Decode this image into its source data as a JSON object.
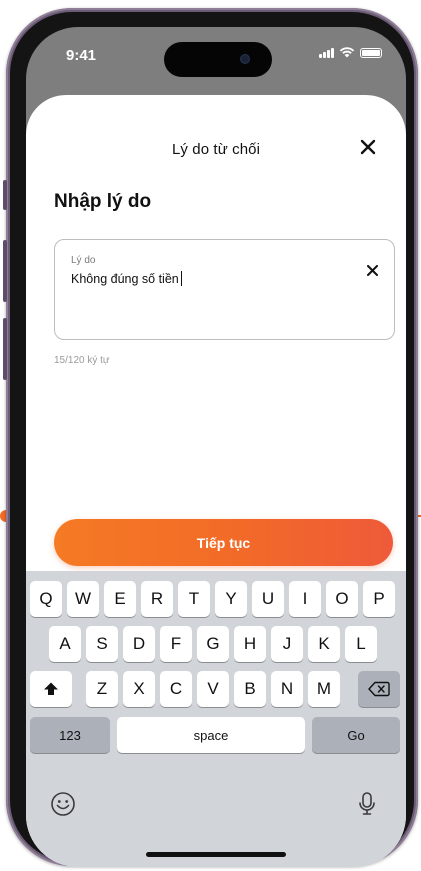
{
  "status": {
    "time": "9:41"
  },
  "sheet": {
    "title": "Lý do từ chối",
    "heading": "Nhập lý do",
    "field_label": "Lý do",
    "field_value": "Không đúng số tiền",
    "counter": "15/120 ký tự",
    "cta_label": "Tiếp tục"
  },
  "keyboard": {
    "row1": [
      "Q",
      "W",
      "E",
      "R",
      "T",
      "Y",
      "U",
      "I",
      "O",
      "P"
    ],
    "row2": [
      "A",
      "S",
      "D",
      "F",
      "G",
      "H",
      "J",
      "K",
      "L"
    ],
    "row3": [
      "Z",
      "X",
      "C",
      "V",
      "B",
      "N",
      "M"
    ],
    "numbers_label": "123",
    "space_label": "space",
    "go_label": "Go"
  },
  "colors": {
    "accent": "#F26B25",
    "keyboard_bg": "#D1D4D9"
  }
}
